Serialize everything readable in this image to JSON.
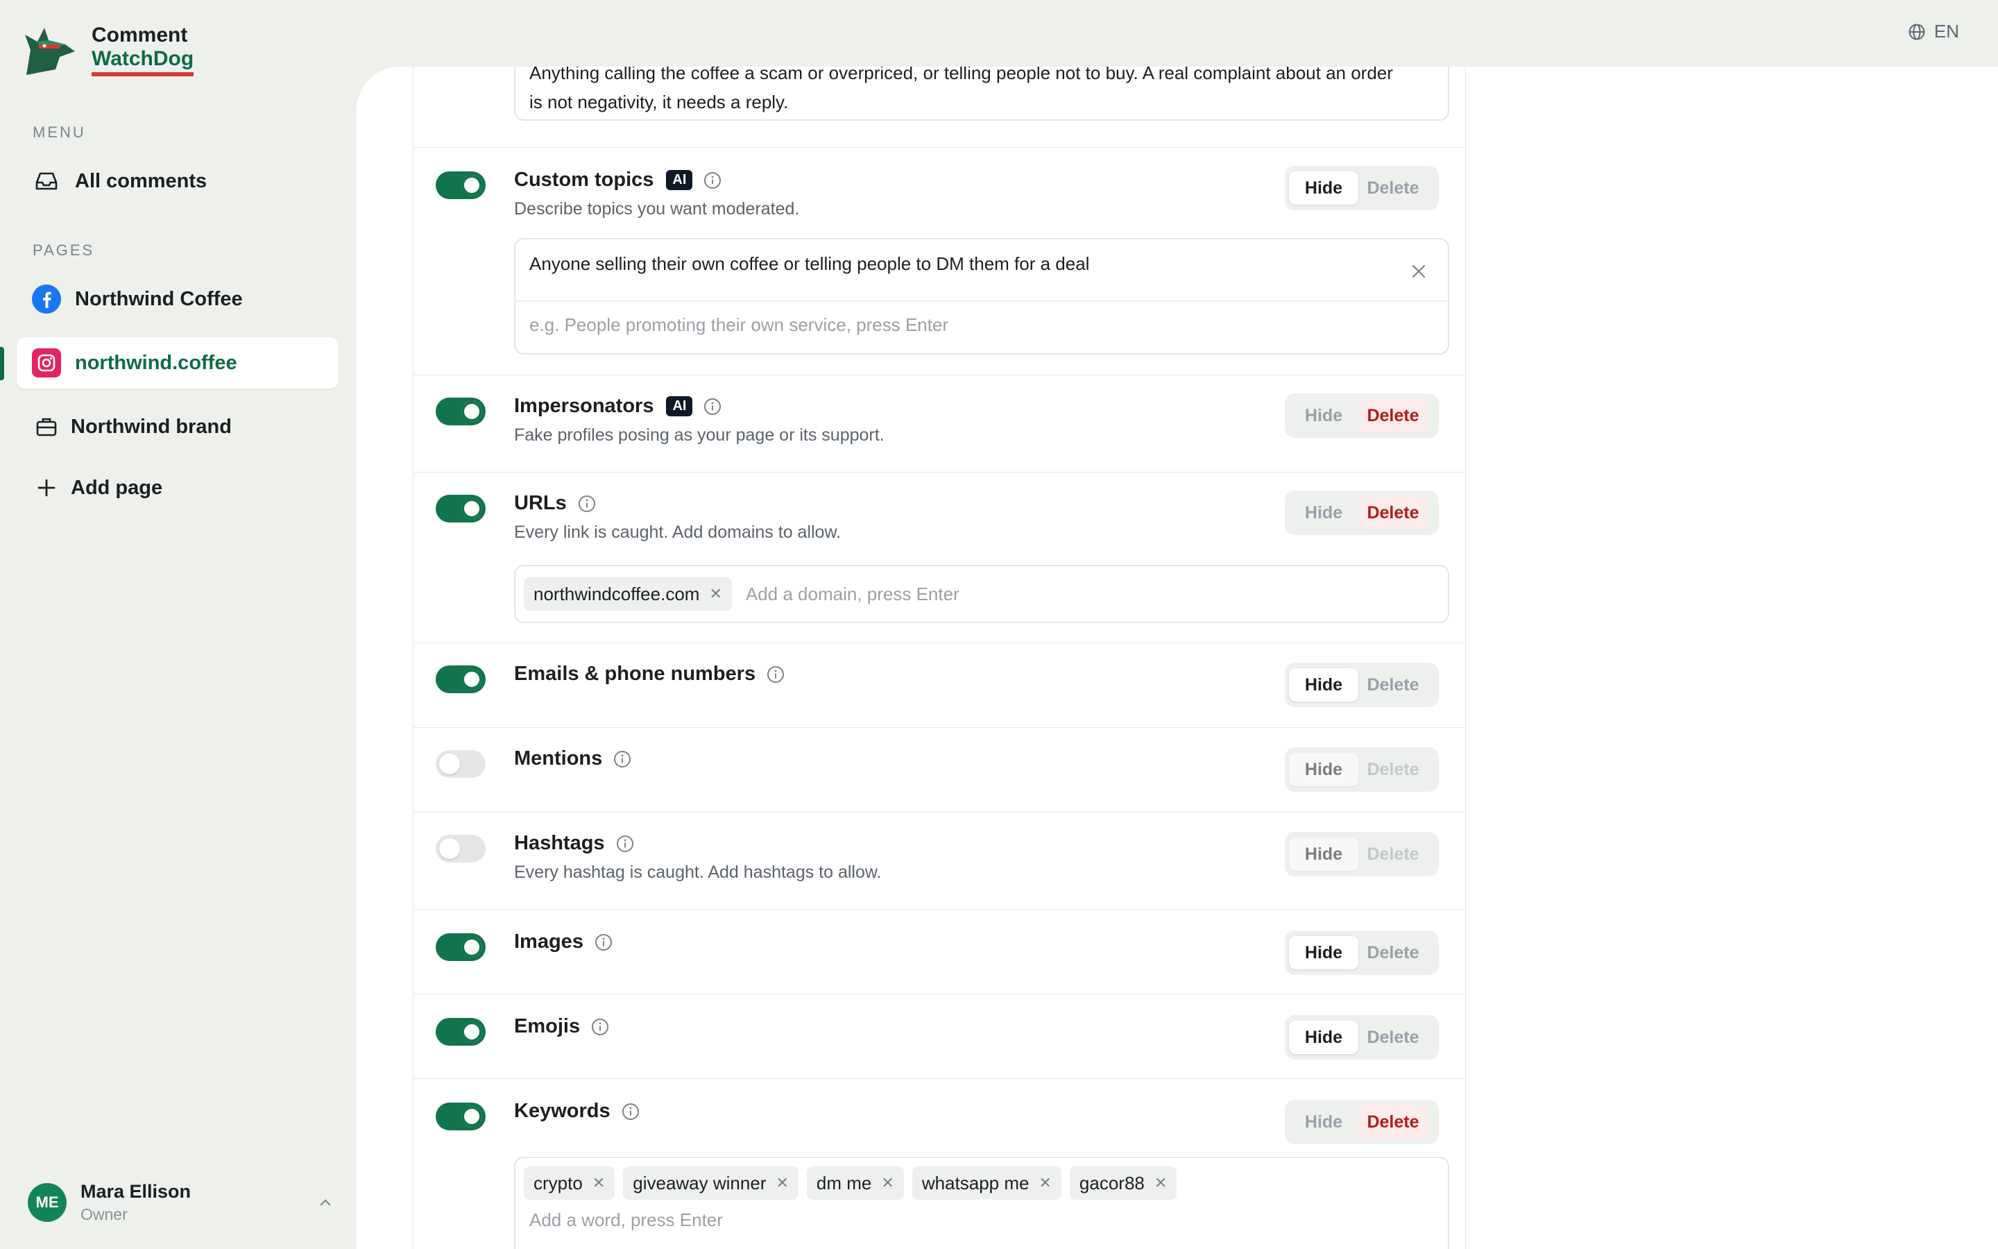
{
  "brand": {
    "line1": "Comment",
    "line2": "WatchDog"
  },
  "lang": "EN",
  "sidebar": {
    "menu_label": "MENU",
    "all_comments": "All comments",
    "pages_label": "PAGES",
    "pages": [
      {
        "label": "Northwind Coffee",
        "icon": "facebook-icon"
      },
      {
        "label": "northwind.coffee",
        "icon": "instagram-icon",
        "active": true
      },
      {
        "label": "Northwind brand",
        "icon": "briefcase-icon"
      }
    ],
    "add_page": "Add page"
  },
  "user": {
    "initials": "ME",
    "name": "Mara Ellison",
    "role": "Owner"
  },
  "negativity": {
    "text_line1": "Anything calling the coffee a scam or overpriced, or telling people not to buy. A real complaint about an order",
    "text_line2": "is not negativity, it needs a reply."
  },
  "rules": {
    "custom_topics": {
      "title": "Custom topics",
      "badge": "AI",
      "desc": "Describe topics you want moderated.",
      "entry": "Anyone selling their own coffee or telling people to DM them for a deal",
      "placeholder": "e.g. People promoting their own service, press Enter",
      "hide": "Hide",
      "delete": "Delete"
    },
    "impersonators": {
      "title": "Impersonators",
      "badge": "AI",
      "desc": "Fake profiles posing as your page or its support.",
      "hide": "Hide",
      "delete": "Delete"
    },
    "urls": {
      "title": "URLs",
      "desc": "Every link is caught. Add domains to allow.",
      "chip": "northwindcoffee.com",
      "placeholder": "Add a domain, press Enter",
      "hide": "Hide",
      "delete": "Delete"
    },
    "emails": {
      "title": "Emails & phone numbers",
      "hide": "Hide",
      "delete": "Delete"
    },
    "mentions": {
      "title": "Mentions",
      "hide": "Hide",
      "delete": "Delete"
    },
    "hashtags": {
      "title": "Hashtags",
      "desc": "Every hashtag is caught. Add hashtags to allow.",
      "hide": "Hide",
      "delete": "Delete"
    },
    "images": {
      "title": "Images",
      "hide": "Hide",
      "delete": "Delete"
    },
    "emojis": {
      "title": "Emojis",
      "hide": "Hide",
      "delete": "Delete"
    },
    "keywords": {
      "title": "Keywords",
      "chips": [
        "crypto",
        "giveaway winner",
        "dm me",
        "whatsapp me",
        "gacor88"
      ],
      "placeholder": "Add a word, press Enter",
      "hide": "Hide",
      "delete": "Delete"
    }
  },
  "colors": {
    "accent": "#0f6b46",
    "danger": "#b11d1d",
    "brand_underline": "#d63a2f"
  }
}
